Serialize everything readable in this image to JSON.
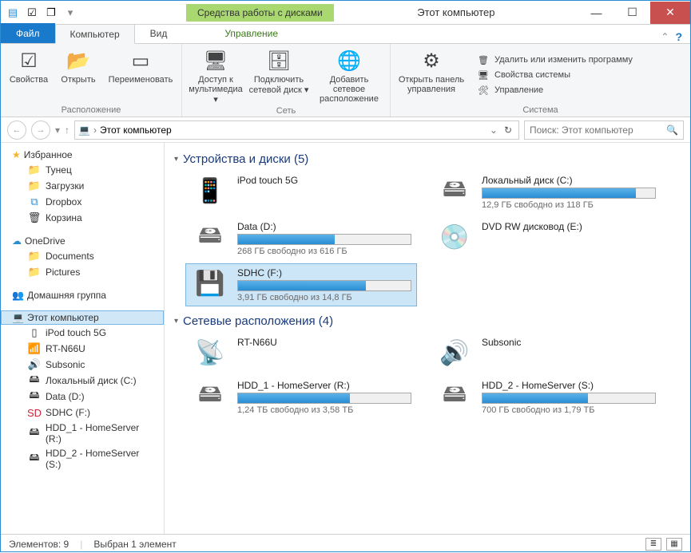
{
  "window": {
    "title": "Этот компьютер",
    "context_tab": "Средства работы с дисками"
  },
  "tabs": {
    "file": "Файл",
    "computer": "Компьютер",
    "view": "Вид",
    "manage": "Управление"
  },
  "ribbon": {
    "location": {
      "label": "Расположение",
      "properties": "Свойства",
      "open": "Открыть",
      "rename": "Переименовать"
    },
    "network": {
      "label": "Сеть",
      "media": "Доступ к мультимедиа ▾",
      "map_drive": "Подключить сетевой диск ▾",
      "add_location": "Добавить сетевое расположение"
    },
    "system": {
      "label": "Система",
      "control_panel": "Открыть панель управления",
      "uninstall": "Удалить или изменить программу",
      "sys_props": "Свойства системы",
      "manage": "Управление"
    }
  },
  "nav": {
    "breadcrumb": "Этот компьютер",
    "search_placeholder": "Поиск: Этот компьютер"
  },
  "sidebar": {
    "favorites": {
      "label": "Избранное",
      "items": [
        "Тунец",
        "Загрузки",
        "Dropbox",
        "Корзина"
      ]
    },
    "onedrive": {
      "label": "OneDrive",
      "items": [
        "Documents",
        "Pictures"
      ]
    },
    "homegroup": "Домашняя группа",
    "thispc": {
      "label": "Этот компьютер",
      "items": [
        "iPod touch 5G",
        "RT-N66U",
        "Subsonic",
        "Локальный диск (C:)",
        "Data (D:)",
        "SDHC (F:)",
        "HDD_1 - HomeServer (R:)",
        "HDD_2 - HomeServer (S:)"
      ]
    }
  },
  "sections": {
    "drives": {
      "title": "Устройства и диски (5)"
    },
    "network": {
      "title": "Сетевые расположения (4)"
    }
  },
  "drives": [
    {
      "name": "iPod touch 5G",
      "sub": "",
      "fill": 0,
      "no_bar": true
    },
    {
      "name": "Локальный диск (C:)",
      "sub": "12,9 ГБ свободно из 118 ГБ",
      "fill": 89
    },
    {
      "name": "Data (D:)",
      "sub": "268 ГБ свободно из 616 ГБ",
      "fill": 56
    },
    {
      "name": "DVD RW дисковод (E:)",
      "sub": "",
      "fill": 0,
      "no_bar": true
    },
    {
      "name": "SDHC (F:)",
      "sub": "3,91 ГБ свободно из 14,8 ГБ",
      "fill": 74,
      "selected": true
    }
  ],
  "network_locations": [
    {
      "name": "RT-N66U",
      "sub": "",
      "no_bar": true
    },
    {
      "name": "Subsonic",
      "sub": "",
      "no_bar": true
    },
    {
      "name": "HDD_1 - HomeServer (R:)",
      "sub": "1,24 ТБ свободно из 3,58 ТБ",
      "fill": 65
    },
    {
      "name": "HDD_2 - HomeServer (S:)",
      "sub": "700 ГБ свободно из 1,79 ТБ",
      "fill": 61
    }
  ],
  "status": {
    "items": "Элементов: 9",
    "selected": "Выбран 1 элемент"
  }
}
